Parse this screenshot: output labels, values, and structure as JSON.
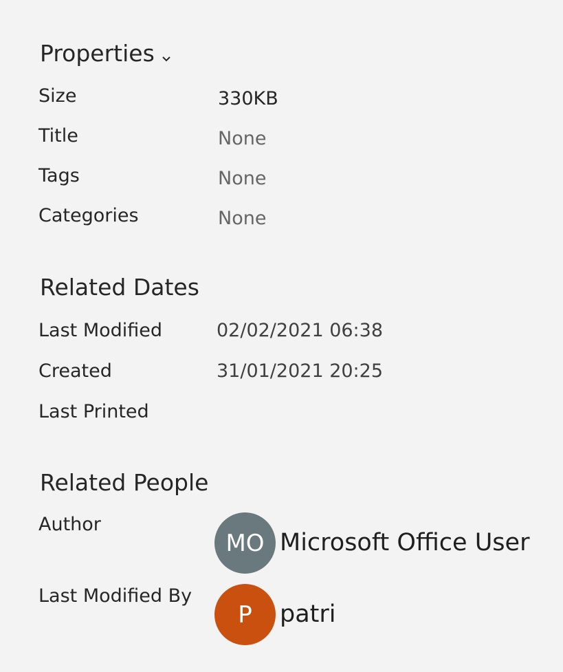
{
  "properties": {
    "title": "Properties",
    "rows": [
      {
        "label": "Size",
        "value": "330KB"
      },
      {
        "label": "Title",
        "value": "None"
      },
      {
        "label": "Tags",
        "value": "None"
      },
      {
        "label": "Categories",
        "value": "None"
      }
    ]
  },
  "related_dates": {
    "title": "Related Dates",
    "rows": [
      {
        "label": "Last Modified",
        "value": "02/02/2021 06:38"
      },
      {
        "label": "Created",
        "value": "31/01/2021 20:25"
      },
      {
        "label": "Last Printed",
        "value": ""
      }
    ]
  },
  "related_people": {
    "title": "Related People",
    "author": {
      "label": "Author",
      "initials": "MO",
      "name": "Microsoft Office User",
      "avatar_color": "#69797e"
    },
    "last_modified_by": {
      "label": "Last Modified By",
      "initials": "P",
      "name": "patri",
      "avatar_color": "#ca5010"
    }
  },
  "icons": {
    "properties_toggle": "chevron-down-icon"
  }
}
